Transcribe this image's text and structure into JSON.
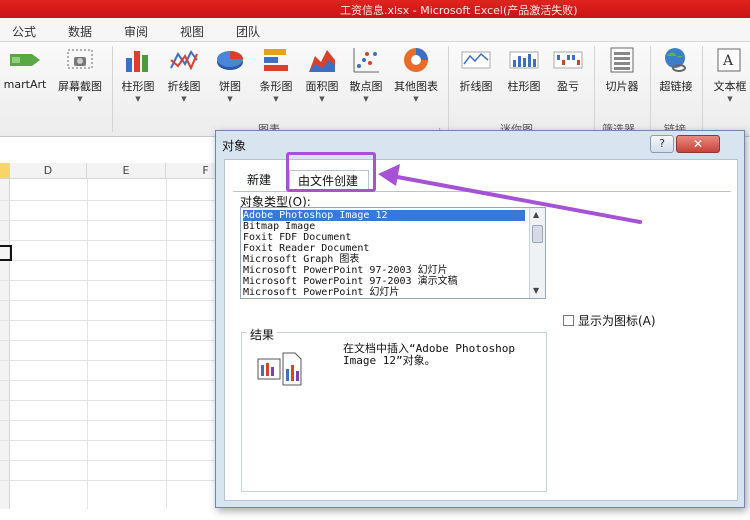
{
  "window": {
    "title": "工资信息.xlsx - Microsoft Excel(产品激活失败)"
  },
  "ribbon_tabs": [
    "公式",
    "数据",
    "审阅",
    "视图",
    "团队"
  ],
  "ribbon": {
    "buttons": {
      "smartart": "martArt",
      "screenshot": "屏幕截图",
      "column_chart": "柱形图",
      "line_chart": "折线图",
      "pie_chart": "饼图",
      "bar_chart": "条形图",
      "area_chart": "面积图",
      "scatter_chart": "散点图",
      "other_chart": "其他图表",
      "spark_line": "折线图",
      "spark_column": "柱形图",
      "spark_winloss": "盈亏",
      "slicer": "切片器",
      "hyperlink": "超链接",
      "textbox": "文本框"
    },
    "groups": {
      "charts": "图表",
      "sparklines": "迷你图",
      "filter": "筛选器",
      "links": "链接"
    }
  },
  "sheet": {
    "columns": [
      "D",
      "E",
      "F"
    ]
  },
  "dialog": {
    "title": "对象",
    "help_label": "?",
    "close_label": "✕",
    "tabs": {
      "new": "新建",
      "from_file": "由文件创建"
    },
    "object_type_label": "对象类型(O):",
    "object_types": [
      "Adobe Photoshop Image 12",
      "Bitmap Image",
      "Foxit FDF Document",
      "Foxit Reader Document",
      "Microsoft Graph 图表",
      "Microsoft PowerPoint 97-2003 幻灯片",
      "Microsoft PowerPoint 97-2003 演示文稿",
      "Microsoft PowerPoint 幻灯片"
    ],
    "selected_index": 0,
    "display_as_icon": "显示为图标(A)",
    "result_label": "结果",
    "result_text": "在文档中插入“Adobe Photoshop Image 12”对象。"
  },
  "colors": {
    "title_bar": "#d11b17",
    "selection": "#3a78d8",
    "annotation": "#a552d6"
  }
}
